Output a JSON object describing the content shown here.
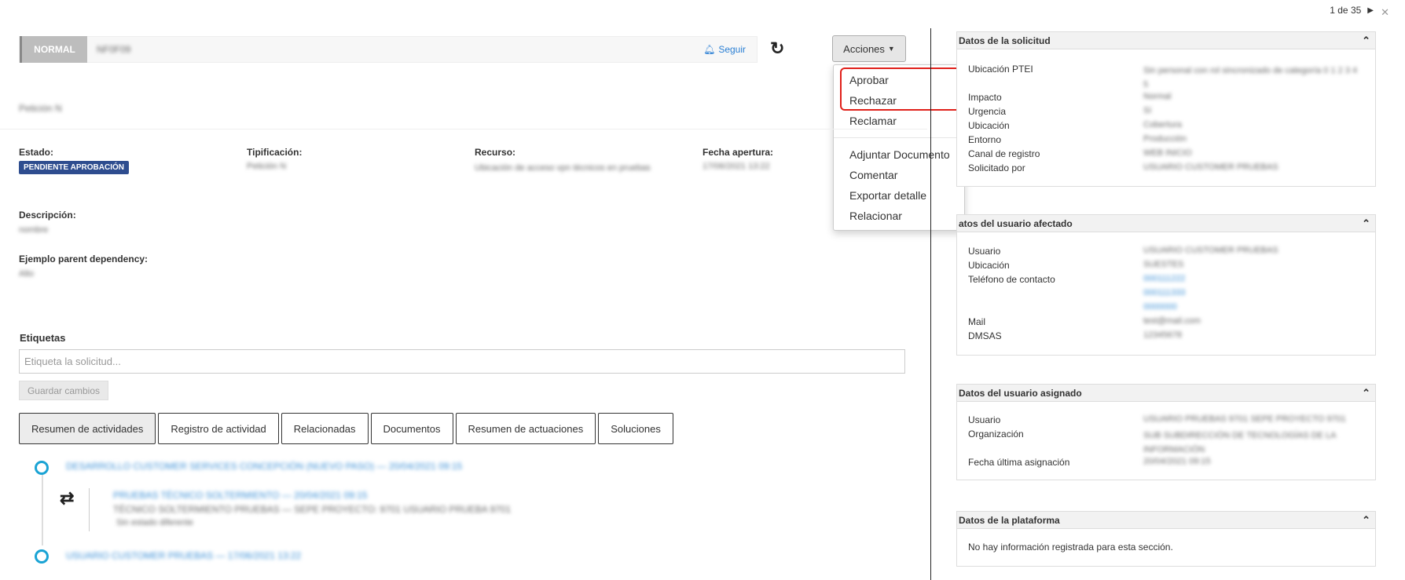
{
  "pager": {
    "text": "1 de 35"
  },
  "header": {
    "priority": "NORMAL",
    "title": "NF0F09",
    "follow": "Seguir"
  },
  "actions_button": {
    "label": "Acciones"
  },
  "actions_menu": {
    "items": [
      "Aprobar",
      "Rechazar",
      "Reclamar",
      "Adjuntar Documento",
      "Comentar",
      "Exportar detalle",
      "Relacionar"
    ]
  },
  "ticket_id": "Petición N",
  "fields": {
    "estado": {
      "label": "Estado:",
      "value": "PENDIENTE APROBACIÓN"
    },
    "tipificacion": {
      "label": "Tipificación:",
      "value": "Petición N"
    },
    "recurso": {
      "label": "Recurso:",
      "value": "Ubicación de acceso vpn técnicos en pruebas"
    },
    "fecha_apertura": {
      "label": "Fecha apertura:",
      "value": "17/06/2021 13:22"
    },
    "descripcion": {
      "label": "Descripción:",
      "value": "nombre"
    },
    "parent_dependency": {
      "label": "Ejemplo parent dependency:",
      "value": "Alto"
    }
  },
  "tags": {
    "label": "Etiquetas",
    "placeholder": "Etiqueta la solicitud...",
    "save_label": "Guardar cambios"
  },
  "tabs": [
    "Resumen de actividades",
    "Registro de actividad",
    "Relacionadas",
    "Documentos",
    "Resumen de actuaciones",
    "Soluciones"
  ],
  "timeline": {
    "item1": "DESARROLLO CUSTOMER SERVICES CONCEPCIÓN (NUEVO PASO) — 20/04/2021 09:15",
    "item2_title": "PRUEBAS TÉCNICO SOLTERMIENTO — 20/04/2021 09:15",
    "item2_body": "TÉCNICO SOLTERMIENTO PRUEBAS — SEPE PROYECTO: 9701 USUARIO PRUEBA 9701",
    "item2_note": "Sin estado diferente",
    "item3": "USUARIO CUSTOMER PRUEBAS — 17/06/2021 13:22"
  },
  "panels": {
    "solicitud": {
      "title": "Datos de la solicitud",
      "rows": [
        {
          "label": "Ubicación PTEI",
          "value": "Sin personal con rol sincronizado de categoría 0 1 2 3 4 5"
        },
        {
          "label": "Impacto",
          "value": "Normal"
        },
        {
          "label": "Urgencia",
          "value": "Sí"
        },
        {
          "label": "Ubicación",
          "value": "Cobertura"
        },
        {
          "label": "Entorno",
          "value": "Producción"
        },
        {
          "label": "Canal de registro",
          "value": "WEB INICIO"
        },
        {
          "label": "Solicitado por",
          "value": "USUARIO CUSTOMER PRUEBAS"
        }
      ]
    },
    "afectado": {
      "title": "atos del usuario afectado",
      "rows": [
        {
          "label": "Usuario",
          "value": "USUARIO CUSTOMER PRUEBAS"
        },
        {
          "label": "Ubicación",
          "value": "SUESTES"
        },
        {
          "label": "Teléfono de contacto",
          "value": "000111222"
        },
        {
          "label": "Mail",
          "value": "test@mail.com"
        },
        {
          "label": "DMSAS",
          "value": "12345678"
        }
      ],
      "phones": [
        "000111222",
        "000111333",
        "0000000"
      ]
    },
    "asignado": {
      "title": "Datos del usuario asignado",
      "rows": [
        {
          "label": "Usuario",
          "value": "USUARIO PRUEBAS 9701 SEPE PROYECTO 9701"
        },
        {
          "label": "Organización",
          "value": "SUB SUBDIRECCIÓN DE TECNOLOGÍAS DE LA INFORMACIÓN"
        },
        {
          "label": "Fecha última asignación",
          "value": "20/04/2021 09:15"
        }
      ]
    },
    "plataforma": {
      "title": "Datos de la plataforma",
      "empty": "No hay información registrada para esta sección."
    }
  }
}
